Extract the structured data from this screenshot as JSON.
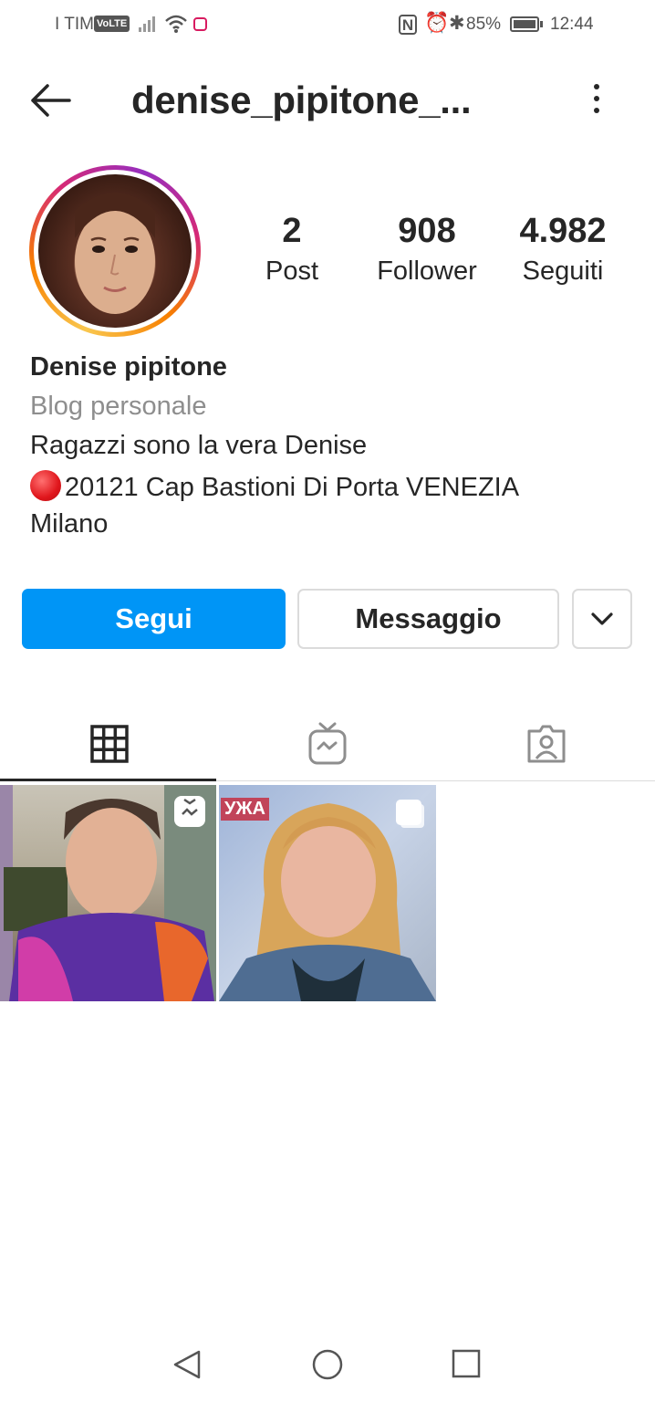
{
  "status_bar": {
    "carrier": "I TIM",
    "volte": "VoLTE",
    "nfc": "N",
    "battery": "85%",
    "time": "12:44"
  },
  "header": {
    "username": "denise_pipitone_..."
  },
  "stats": {
    "posts": {
      "value": "2",
      "label": "Post"
    },
    "followers": {
      "value": "908",
      "label": "Follower"
    },
    "following": {
      "value": "4.982",
      "label": "Seguiti"
    }
  },
  "bio": {
    "name": "Denise pipitone",
    "category": "Blog personale",
    "line1": "Ragazzi sono la vera Denise",
    "line2": "20121 Cap Bastioni Di Porta VENEZIA",
    "line3": "Milano"
  },
  "actions": {
    "follow": "Segui",
    "message": "Messaggio"
  },
  "tabs": [
    {
      "icon": "grid-icon",
      "active": true
    },
    {
      "icon": "igtv-icon",
      "active": false
    },
    {
      "icon": "tagged-icon",
      "active": false
    }
  ],
  "posts": [
    {
      "type": "igtv",
      "badge": "igtv-icon"
    },
    {
      "type": "carousel",
      "badge": "multiple-photos-icon",
      "overlay_text": "УЖА"
    }
  ],
  "colors": {
    "primary_button": "#0095f6",
    "text": "#262626",
    "secondary_text": "#8e8e8e",
    "border": "#dbdbdb"
  }
}
